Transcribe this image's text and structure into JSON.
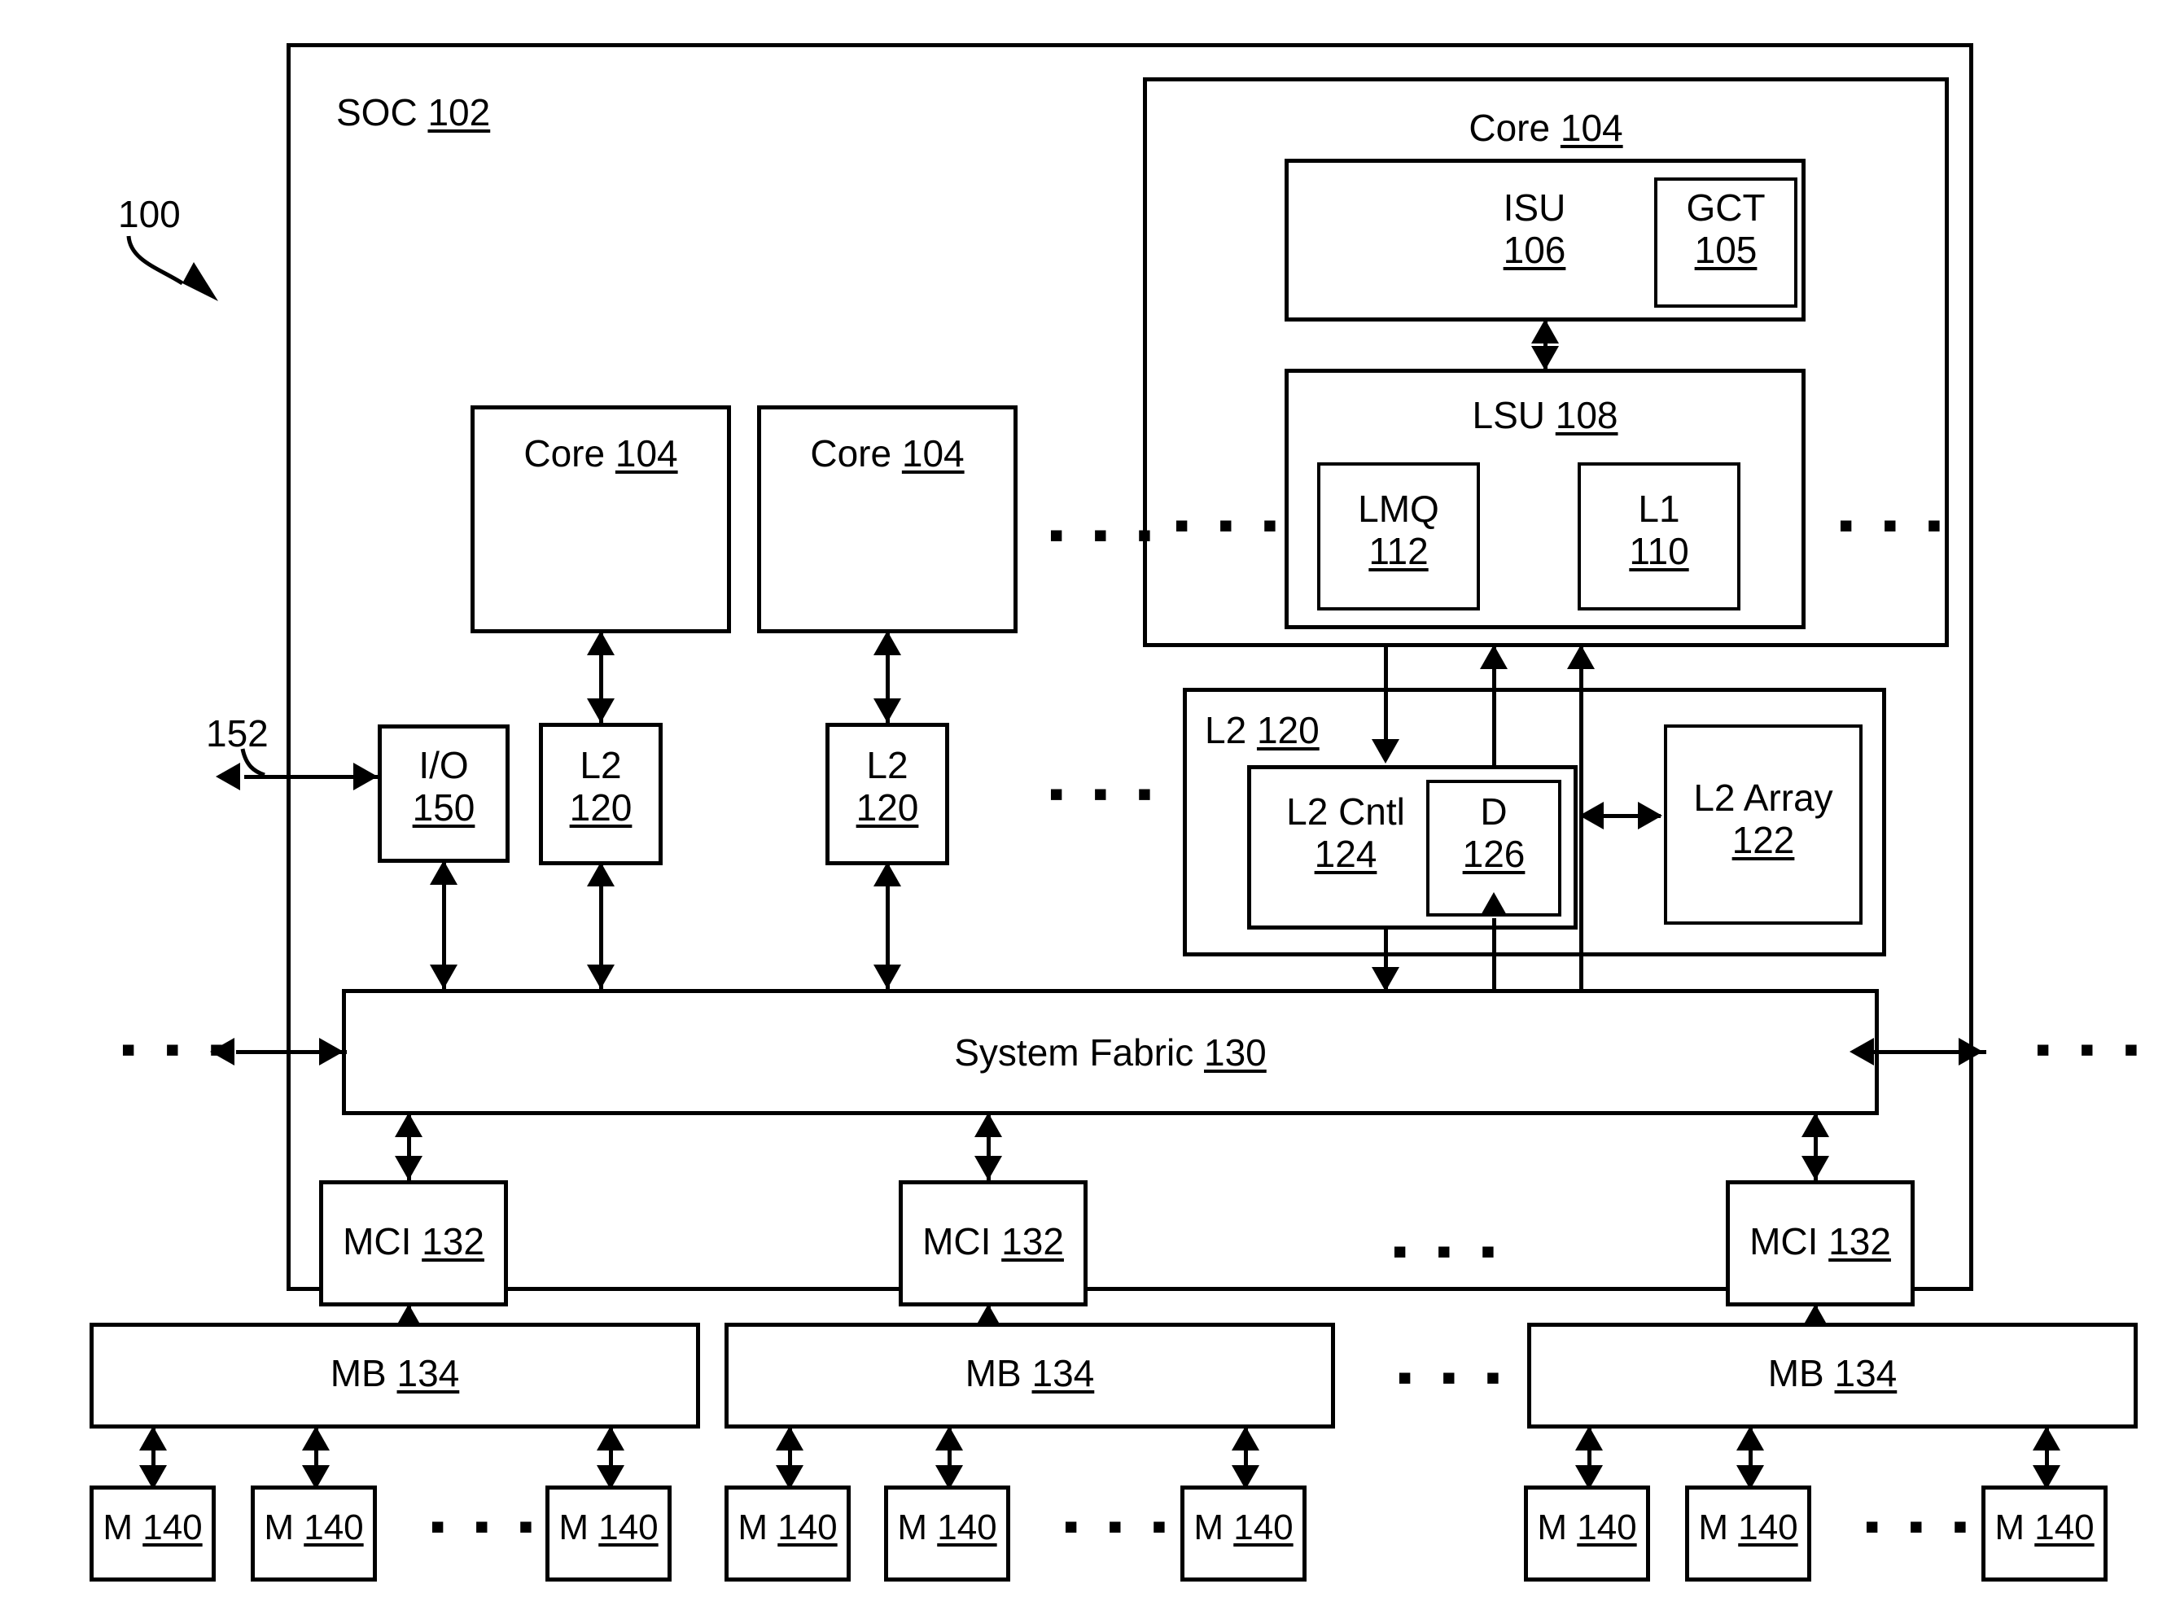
{
  "figure": {
    "ref_100": "100",
    "ref_152": "152",
    "ellipsis": "▪ ▪ ▪"
  },
  "soc": {
    "name": "SOC",
    "ref": "102"
  },
  "cores": [
    {
      "name": "Core",
      "ref": "104"
    },
    {
      "name": "Core",
      "ref": "104"
    }
  ],
  "core_detail": {
    "name": "Core",
    "ref": "104",
    "isu": {
      "name": "ISU",
      "ref": "106"
    },
    "gct": {
      "name": "GCT",
      "ref": "105"
    },
    "lsu": {
      "name": "LSU",
      "ref": "108"
    },
    "lmq": {
      "name": "LMQ",
      "ref": "112"
    },
    "l1": {
      "name": "L1",
      "ref": "110"
    }
  },
  "io": {
    "name": "I/O",
    "ref": "150"
  },
  "l2_simple": [
    {
      "name": "L2",
      "ref": "120"
    },
    {
      "name": "L2",
      "ref": "120"
    }
  ],
  "l2_detail": {
    "name": "L2",
    "ref": "120",
    "cntl": {
      "name": "L2 Cntl",
      "ref": "124"
    },
    "d": {
      "name": "D",
      "ref": "126"
    },
    "array": {
      "name": "L2 Array",
      "ref": "122"
    }
  },
  "fabric": {
    "name": "System Fabric",
    "ref": "130"
  },
  "mci": [
    {
      "name": "MCI",
      "ref": "132"
    },
    {
      "name": "MCI",
      "ref": "132"
    },
    {
      "name": "MCI",
      "ref": "132"
    }
  ],
  "mb": [
    {
      "name": "MB",
      "ref": "134"
    },
    {
      "name": "MB",
      "ref": "134"
    },
    {
      "name": "MB",
      "ref": "134"
    }
  ],
  "memories": [
    {
      "name": "M",
      "ref": "140"
    },
    {
      "name": "M",
      "ref": "140"
    },
    {
      "name": "M",
      "ref": "140"
    },
    {
      "name": "M",
      "ref": "140"
    },
    {
      "name": "M",
      "ref": "140"
    },
    {
      "name": "M",
      "ref": "140"
    },
    {
      "name": "M",
      "ref": "140"
    },
    {
      "name": "M",
      "ref": "140"
    },
    {
      "name": "M",
      "ref": "140"
    }
  ],
  "colors": {
    "ink": "#000000",
    "paper": "#ffffff"
  }
}
